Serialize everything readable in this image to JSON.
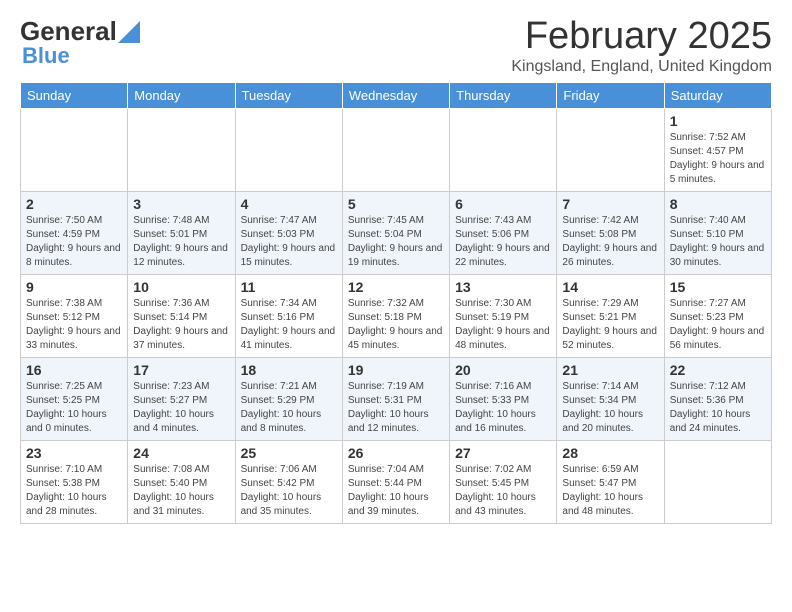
{
  "header": {
    "logo_general": "General",
    "logo_blue": "Blue",
    "title": "February 2025",
    "subtitle": "Kingsland, England, United Kingdom"
  },
  "weekdays": [
    "Sunday",
    "Monday",
    "Tuesday",
    "Wednesday",
    "Thursday",
    "Friday",
    "Saturday"
  ],
  "weeks": [
    [
      {
        "num": "",
        "info": ""
      },
      {
        "num": "",
        "info": ""
      },
      {
        "num": "",
        "info": ""
      },
      {
        "num": "",
        "info": ""
      },
      {
        "num": "",
        "info": ""
      },
      {
        "num": "",
        "info": ""
      },
      {
        "num": "1",
        "info": "Sunrise: 7:52 AM\nSunset: 4:57 PM\nDaylight: 9 hours and 5 minutes."
      }
    ],
    [
      {
        "num": "2",
        "info": "Sunrise: 7:50 AM\nSunset: 4:59 PM\nDaylight: 9 hours and 8 minutes."
      },
      {
        "num": "3",
        "info": "Sunrise: 7:48 AM\nSunset: 5:01 PM\nDaylight: 9 hours and 12 minutes."
      },
      {
        "num": "4",
        "info": "Sunrise: 7:47 AM\nSunset: 5:03 PM\nDaylight: 9 hours and 15 minutes."
      },
      {
        "num": "5",
        "info": "Sunrise: 7:45 AM\nSunset: 5:04 PM\nDaylight: 9 hours and 19 minutes."
      },
      {
        "num": "6",
        "info": "Sunrise: 7:43 AM\nSunset: 5:06 PM\nDaylight: 9 hours and 22 minutes."
      },
      {
        "num": "7",
        "info": "Sunrise: 7:42 AM\nSunset: 5:08 PM\nDaylight: 9 hours and 26 minutes."
      },
      {
        "num": "8",
        "info": "Sunrise: 7:40 AM\nSunset: 5:10 PM\nDaylight: 9 hours and 30 minutes."
      }
    ],
    [
      {
        "num": "9",
        "info": "Sunrise: 7:38 AM\nSunset: 5:12 PM\nDaylight: 9 hours and 33 minutes."
      },
      {
        "num": "10",
        "info": "Sunrise: 7:36 AM\nSunset: 5:14 PM\nDaylight: 9 hours and 37 minutes."
      },
      {
        "num": "11",
        "info": "Sunrise: 7:34 AM\nSunset: 5:16 PM\nDaylight: 9 hours and 41 minutes."
      },
      {
        "num": "12",
        "info": "Sunrise: 7:32 AM\nSunset: 5:18 PM\nDaylight: 9 hours and 45 minutes."
      },
      {
        "num": "13",
        "info": "Sunrise: 7:30 AM\nSunset: 5:19 PM\nDaylight: 9 hours and 48 minutes."
      },
      {
        "num": "14",
        "info": "Sunrise: 7:29 AM\nSunset: 5:21 PM\nDaylight: 9 hours and 52 minutes."
      },
      {
        "num": "15",
        "info": "Sunrise: 7:27 AM\nSunset: 5:23 PM\nDaylight: 9 hours and 56 minutes."
      }
    ],
    [
      {
        "num": "16",
        "info": "Sunrise: 7:25 AM\nSunset: 5:25 PM\nDaylight: 10 hours and 0 minutes."
      },
      {
        "num": "17",
        "info": "Sunrise: 7:23 AM\nSunset: 5:27 PM\nDaylight: 10 hours and 4 minutes."
      },
      {
        "num": "18",
        "info": "Sunrise: 7:21 AM\nSunset: 5:29 PM\nDaylight: 10 hours and 8 minutes."
      },
      {
        "num": "19",
        "info": "Sunrise: 7:19 AM\nSunset: 5:31 PM\nDaylight: 10 hours and 12 minutes."
      },
      {
        "num": "20",
        "info": "Sunrise: 7:16 AM\nSunset: 5:33 PM\nDaylight: 10 hours and 16 minutes."
      },
      {
        "num": "21",
        "info": "Sunrise: 7:14 AM\nSunset: 5:34 PM\nDaylight: 10 hours and 20 minutes."
      },
      {
        "num": "22",
        "info": "Sunrise: 7:12 AM\nSunset: 5:36 PM\nDaylight: 10 hours and 24 minutes."
      }
    ],
    [
      {
        "num": "23",
        "info": "Sunrise: 7:10 AM\nSunset: 5:38 PM\nDaylight: 10 hours and 28 minutes."
      },
      {
        "num": "24",
        "info": "Sunrise: 7:08 AM\nSunset: 5:40 PM\nDaylight: 10 hours and 31 minutes."
      },
      {
        "num": "25",
        "info": "Sunrise: 7:06 AM\nSunset: 5:42 PM\nDaylight: 10 hours and 35 minutes."
      },
      {
        "num": "26",
        "info": "Sunrise: 7:04 AM\nSunset: 5:44 PM\nDaylight: 10 hours and 39 minutes."
      },
      {
        "num": "27",
        "info": "Sunrise: 7:02 AM\nSunset: 5:45 PM\nDaylight: 10 hours and 43 minutes."
      },
      {
        "num": "28",
        "info": "Sunrise: 6:59 AM\nSunset: 5:47 PM\nDaylight: 10 hours and 48 minutes."
      },
      {
        "num": "",
        "info": ""
      }
    ]
  ]
}
